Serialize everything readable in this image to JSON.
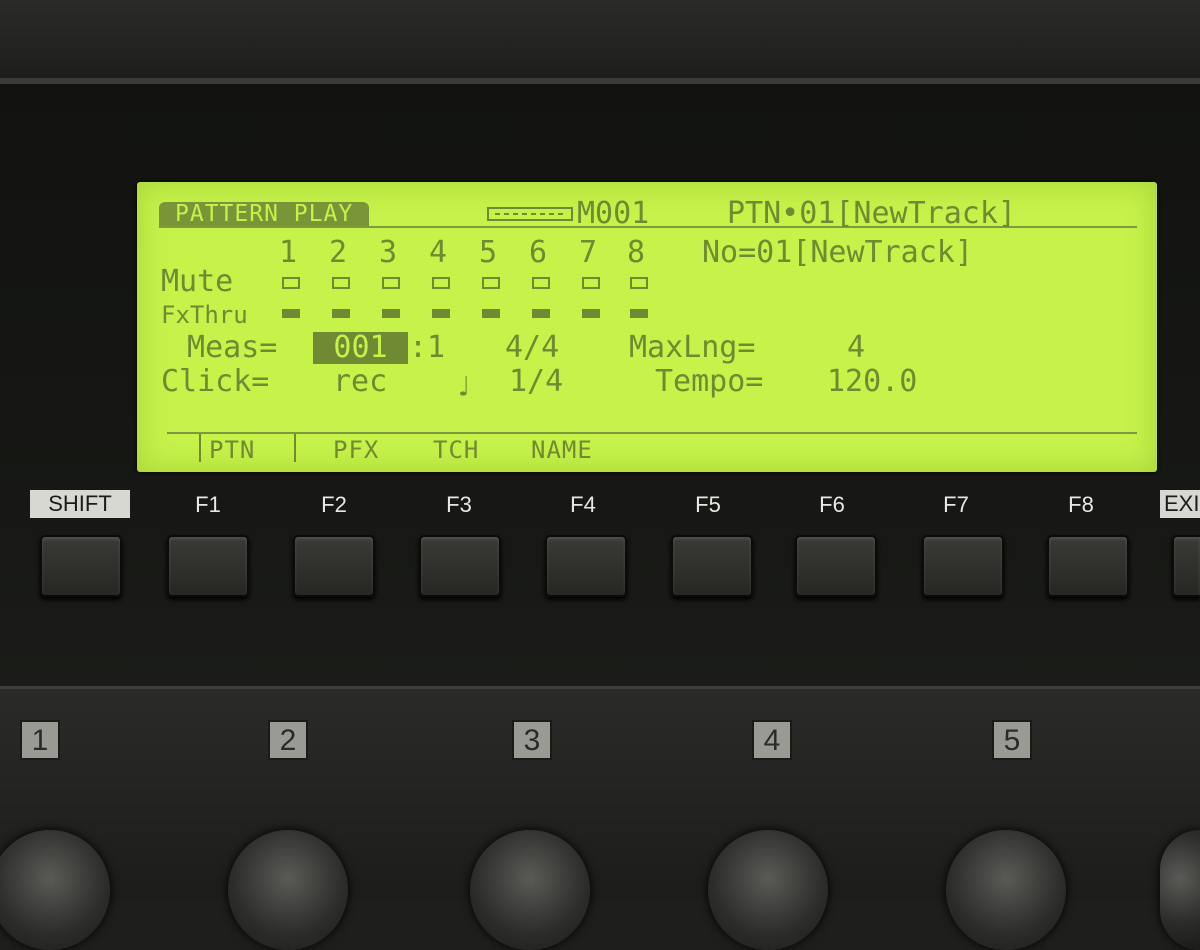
{
  "lcd": {
    "mode_title": "PATTERN PLAY",
    "measure_indicator": "M001",
    "pattern_label": "PTN•01[NewTrack]",
    "tracks": [
      "1",
      "2",
      "3",
      "4",
      "5",
      "6",
      "7",
      "8"
    ],
    "number_label": "No=01[NewTrack]",
    "mute_label": "Mute",
    "fxthru_label": "FxThru",
    "meas_label": " Meas=",
    "meas_value": "001",
    "meas_beat": ":1",
    "time_signature": "4/4",
    "maxlng_label": "MaxLng=",
    "maxlng_value": "4",
    "click_label": "Click=",
    "click_value": "rec",
    "click_division": "1/4",
    "tempo_label": "Tempo=",
    "tempo_value": "120.0",
    "menu": [
      "PTN",
      "PFX",
      "TCH",
      "NAME"
    ]
  },
  "keys": {
    "shift": "SHIFT",
    "functions": [
      "F1",
      "F2",
      "F3",
      "F4",
      "F5",
      "F6",
      "F7",
      "F8"
    ],
    "exit": "EXIT"
  },
  "knobs": [
    "1",
    "2",
    "3",
    "4",
    "5"
  ]
}
